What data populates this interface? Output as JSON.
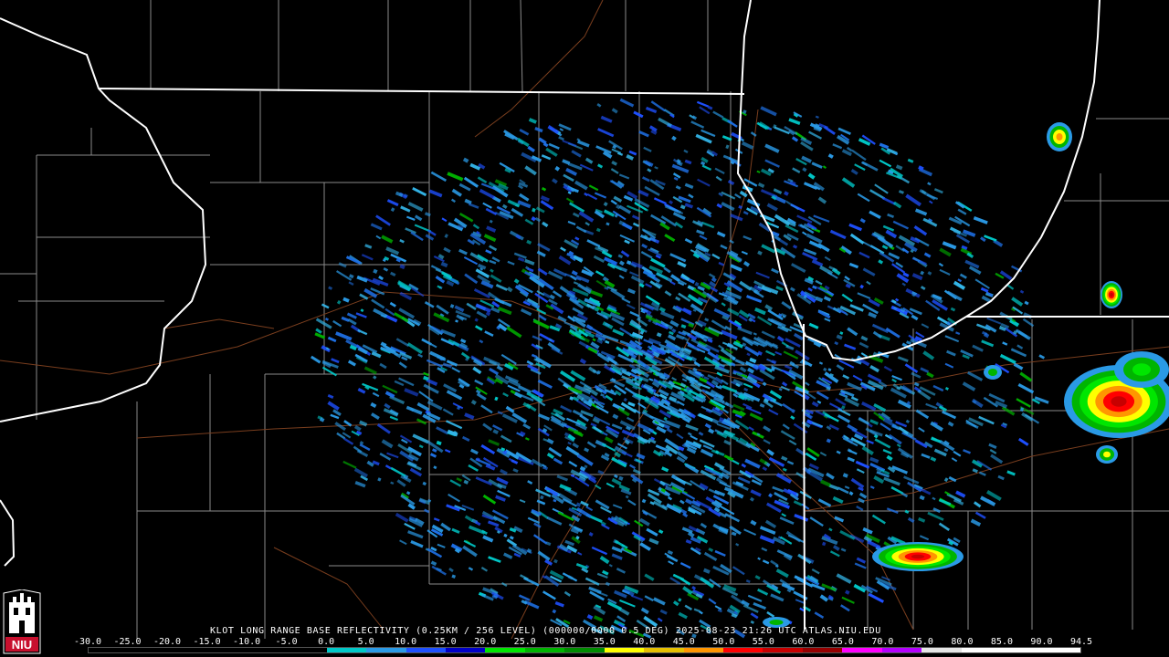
{
  "caption": {
    "radar_id": "KLOT",
    "text": "KLOT LONG RANGE BASE REFLECTIVITY (0.25KM / 256 LEVEL) (000000/0000 0.5 DEG) 2025-08-23 21:26 UTC  ATLAS.NIU.EDU"
  },
  "legend": {
    "ticks": [
      "-30.0",
      "-25.0",
      "-20.0",
      "-15.0",
      "-10.0",
      "-5.0",
      "0.0",
      "5.0",
      "10.0",
      "15.0",
      "20.0",
      "25.0",
      "30.0",
      "35.0",
      "40.0",
      "45.0",
      "50.0",
      "55.0",
      "60.0",
      "65.0",
      "70.0",
      "75.0",
      "80.0",
      "85.0",
      "90.0",
      "94.5"
    ],
    "colors": [
      "#000000",
      "#000000",
      "#000000",
      "#000000",
      "#000000",
      "#000000",
      "#00c8c8",
      "#2a9ae6",
      "#1e50ff",
      "#0000c8",
      "#00e600",
      "#00b400",
      "#008c00",
      "#ffff00",
      "#e6c000",
      "#ff9600",
      "#ff0000",
      "#c80000",
      "#960000",
      "#ff00ff",
      "#b400ff",
      "#e6e6e6",
      "#ffffff",
      "#ffffff",
      "#ffffff"
    ]
  },
  "logo": {
    "text": "NIU",
    "color": "#c8102e"
  },
  "colors": {
    "state_lines": "#ffffff",
    "county_lines": "#8a8a8a",
    "roads": "#7a3e1e",
    "echo_low": "#2a9ae6",
    "echo_mid": "#1e50ff",
    "echo_green": "#00b400"
  }
}
